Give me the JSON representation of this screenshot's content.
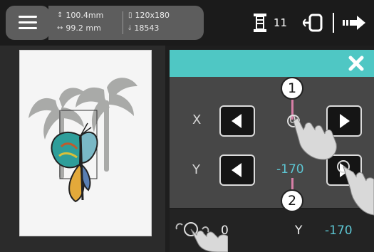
{
  "topbar": {
    "height_value": "100.4mm",
    "width_value": "99.2 mm",
    "frame_size": "120x180",
    "stitch_count": "18543",
    "thread_count": "11"
  },
  "panel": {
    "x_label": "X",
    "x_value": "0",
    "y_label": "Y",
    "y_value": "-170"
  },
  "bottom": {
    "x_value": "0",
    "y_label": "Y",
    "y_value": "-170"
  },
  "callouts": {
    "one": "1",
    "two": "2"
  },
  "colors": {
    "accent": "#4fc7c4",
    "value": "#5dc6d3",
    "leader": "#d77fa7"
  }
}
